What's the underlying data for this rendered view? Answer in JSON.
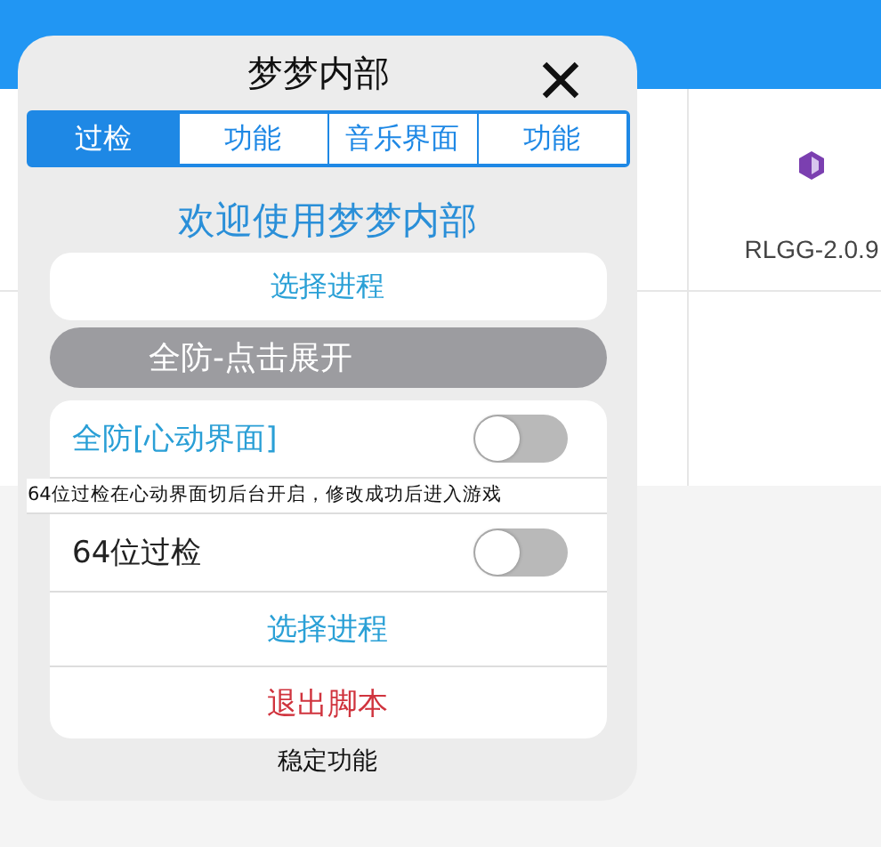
{
  "app": {
    "cells": [
      {
        "label": "RLGG-2.0.9",
        "kind": "app"
      }
    ]
  },
  "dialog": {
    "title": "梦梦内部",
    "tabs": [
      {
        "label": "过检",
        "selected": true
      },
      {
        "label": "功能",
        "selected": false
      },
      {
        "label": "音乐界面",
        "selected": false
      },
      {
        "label": "功能",
        "selected": false
      }
    ],
    "welcome": "欢迎使用梦梦内部",
    "select_button": "选择进程",
    "section_header": "全防-点击展开",
    "items": [
      {
        "kind": "toggle",
        "label": "全防[心动界面]",
        "on": false,
        "highlighted": true
      },
      {
        "kind": "note",
        "text": "64位过检在心动界面切后台开启，修改成功后进入游戏"
      },
      {
        "kind": "toggle",
        "label": "64位过检",
        "on": false,
        "highlighted": false
      },
      {
        "kind": "action",
        "label": "选择进程",
        "color": "#2aa0d6"
      },
      {
        "kind": "action",
        "label": "退出脚本",
        "color": "#d0343e"
      }
    ],
    "footer": "稳定功能"
  }
}
